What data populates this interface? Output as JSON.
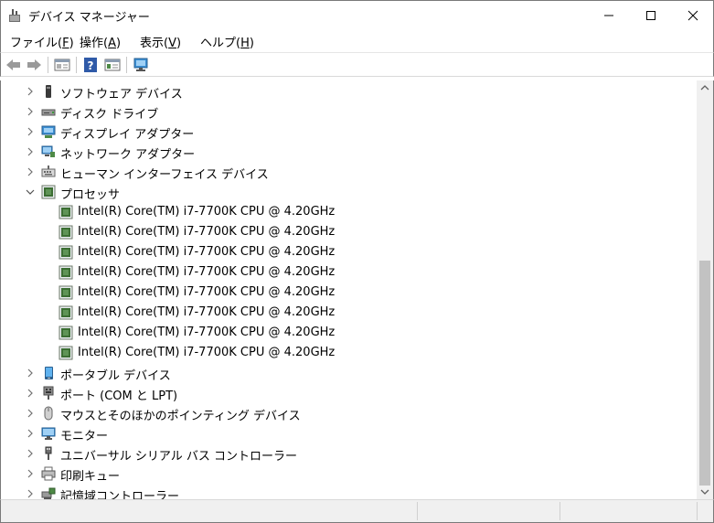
{
  "window": {
    "title": "デバイス マネージャー",
    "controls": {
      "minimize": "—",
      "maximize": "☐",
      "close": "✕"
    }
  },
  "menubar": {
    "items": [
      {
        "label": "ファイル(",
        "accel": "F",
        "suffix": ")"
      },
      {
        "label": "操作(",
        "accel": "A",
        "suffix": ")"
      },
      {
        "label": "表示(",
        "accel": "V",
        "suffix": ")"
      },
      {
        "label": "ヘルプ(",
        "accel": "H",
        "suffix": ")"
      }
    ]
  },
  "toolbar": {
    "buttons": [
      "back-icon",
      "forward-icon",
      "properties-icon",
      "help-icon",
      "details-icon",
      "scan-hardware-icon"
    ]
  },
  "tree": {
    "rows": [
      {
        "label": "ソフトウェア デバイス",
        "icon": "software-device-icon",
        "expand": "collapsed"
      },
      {
        "label": "ディスク ドライブ",
        "icon": "disk-drive-icon",
        "expand": "collapsed"
      },
      {
        "label": "ディスプレイ アダプター",
        "icon": "display-adapter-icon",
        "expand": "collapsed"
      },
      {
        "label": "ネットワーク アダプター",
        "icon": "network-adapter-icon",
        "expand": "collapsed"
      },
      {
        "label": "ヒューマン インターフェイス デバイス",
        "icon": "hid-icon",
        "expand": "collapsed"
      },
      {
        "label": "プロセッサ",
        "icon": "processor-icon",
        "expand": "expanded"
      },
      {
        "label": "Intel(R) Core(TM) i7-7700K CPU @ 4.20GHz",
        "icon": "processor-icon",
        "expand": "child"
      },
      {
        "label": "Intel(R) Core(TM) i7-7700K CPU @ 4.20GHz",
        "icon": "processor-icon",
        "expand": "child"
      },
      {
        "label": "Intel(R) Core(TM) i7-7700K CPU @ 4.20GHz",
        "icon": "processor-icon",
        "expand": "child"
      },
      {
        "label": "Intel(R) Core(TM) i7-7700K CPU @ 4.20GHz",
        "icon": "processor-icon",
        "expand": "child"
      },
      {
        "label": "Intel(R) Core(TM) i7-7700K CPU @ 4.20GHz",
        "icon": "processor-icon",
        "expand": "child"
      },
      {
        "label": "Intel(R) Core(TM) i7-7700K CPU @ 4.20GHz",
        "icon": "processor-icon",
        "expand": "child"
      },
      {
        "label": "Intel(R) Core(TM) i7-7700K CPU @ 4.20GHz",
        "icon": "processor-icon",
        "expand": "child"
      },
      {
        "label": "Intel(R) Core(TM) i7-7700K CPU @ 4.20GHz",
        "icon": "processor-icon",
        "expand": "child"
      },
      {
        "label": "ポータブル デバイス",
        "icon": "portable-device-icon",
        "expand": "collapsed"
      },
      {
        "label": "ポート (COM と LPT)",
        "icon": "port-icon",
        "expand": "collapsed"
      },
      {
        "label": "マウスとそのほかのポインティング デバイス",
        "icon": "mouse-icon",
        "expand": "collapsed"
      },
      {
        "label": "モニター",
        "icon": "monitor-icon",
        "expand": "collapsed"
      },
      {
        "label": "ユニバーサル シリアル バス コントローラー",
        "icon": "usb-icon",
        "expand": "collapsed"
      },
      {
        "label": "印刷キュー",
        "icon": "printer-icon",
        "expand": "collapsed"
      },
      {
        "label": "記憶域コントローラー",
        "icon": "storage-controller-icon",
        "expand": "collapsed"
      }
    ]
  },
  "colors": {
    "chip_green": "#3c6e33",
    "chip_border": "#7a8a72",
    "monitor_blue": "#3b8fd4",
    "scroll_thumb": "#c2c2c2"
  }
}
